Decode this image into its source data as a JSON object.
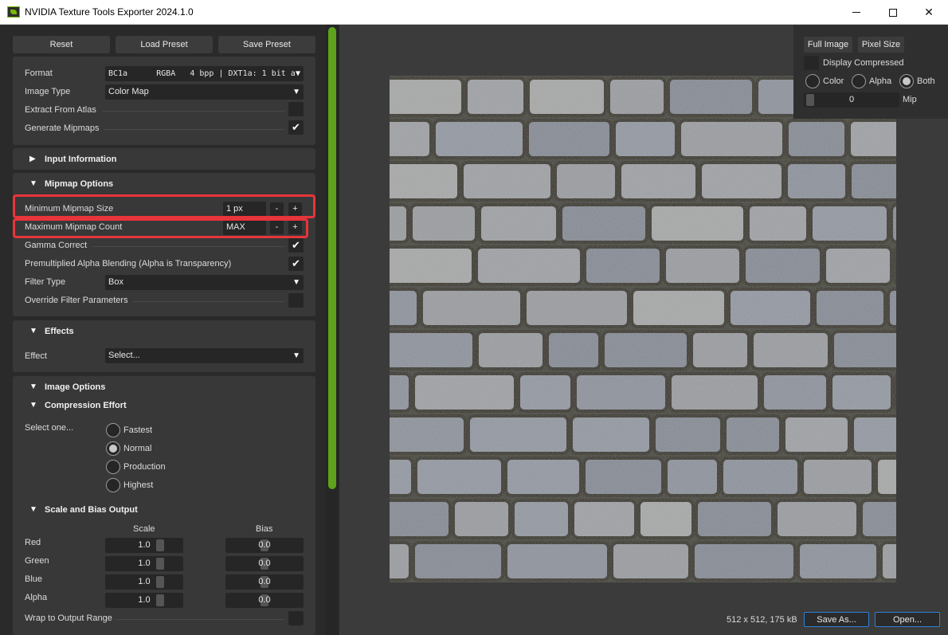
{
  "window": {
    "title": "NVIDIA Texture Tools Exporter 2024.1.0"
  },
  "toolbar": {
    "reset": "Reset",
    "load_preset": "Load Preset",
    "save_preset": "Save Preset"
  },
  "format_group": {
    "format_label": "Format",
    "format_value": "BC1a      RGBA   4 bpp | DXT1a: 1 bit a",
    "image_type_label": "Image Type",
    "image_type_value": "Color Map",
    "extract_atlas_label": "Extract From Atlas",
    "extract_atlas_checked": false,
    "generate_mipmaps_label": "Generate Mipmaps",
    "generate_mipmaps_checked": true
  },
  "input_info": {
    "label": "Input Information"
  },
  "mipmap_options": {
    "label": "Mipmap Options",
    "min_size_label": "Minimum Mipmap Size",
    "min_size_value": "1 px",
    "max_count_label": "Maximum Mipmap Count",
    "max_count_value": "MAX",
    "minus": "-",
    "plus": "+",
    "gamma_label": "Gamma Correct",
    "gamma_checked": true,
    "premult_label": "Premultiplied Alpha Blending (Alpha is Transparency)",
    "premult_checked": true,
    "filter_type_label": "Filter Type",
    "filter_type_value": "Box",
    "override_label": "Override Filter Parameters",
    "override_checked": false
  },
  "effects": {
    "label": "Effects",
    "effect_label": "Effect",
    "effect_value": "Select..."
  },
  "image_options": {
    "label": "Image Options",
    "compression_label": "Compression Effort",
    "select_one": "Select one...",
    "efforts": [
      "Fastest",
      "Normal",
      "Production",
      "Highest"
    ],
    "selected_effort": "Normal",
    "scale_bias_label": "Scale and Bias Output",
    "scale_header": "Scale",
    "bias_header": "Bias",
    "rows": [
      {
        "channel": "Red",
        "scale": "1.0",
        "bias": "0.0"
      },
      {
        "channel": "Green",
        "scale": "1.0",
        "bias": "0.0"
      },
      {
        "channel": "Blue",
        "scale": "1.0",
        "bias": "0.0"
      },
      {
        "channel": "Alpha",
        "scale": "1.0",
        "bias": "0.0"
      }
    ],
    "wrap_label": "Wrap to Output Range",
    "wrap_checked": false
  },
  "viewer": {
    "full_image": "Full Image",
    "pixel_size": "Pixel Size",
    "display_compressed": "Display Compressed",
    "color": "Color",
    "alpha": "Alpha",
    "both": "Both",
    "selected_channel": "Both",
    "mip_value": "0",
    "mip_label": "Mip"
  },
  "status": {
    "info": "512 x 512, 175 kB",
    "save_as": "Save As...",
    "open": "Open..."
  },
  "colors": {
    "accent_green": "#76b900",
    "highlight_red": "#e8353a",
    "button_blue_border": "#2d7fd6"
  }
}
